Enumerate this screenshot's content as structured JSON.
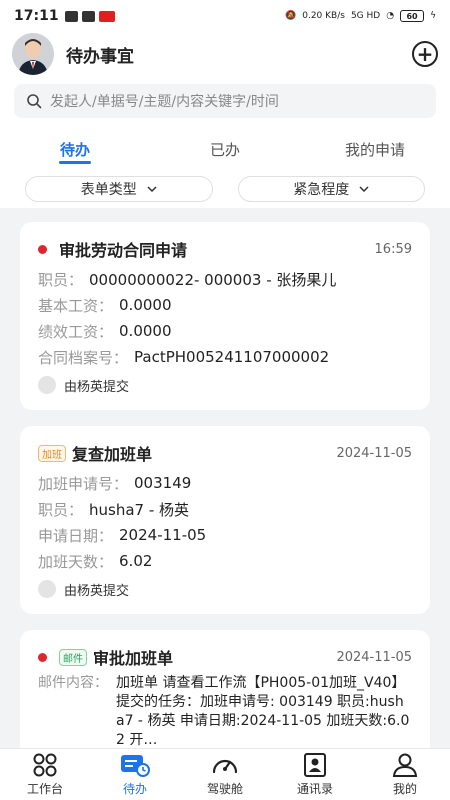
{
  "status_bar": {
    "time": "17:11",
    "net_speed": "0.20 KB/s",
    "network": "5G HD",
    "battery": "60"
  },
  "header": {
    "title": "待办事宜",
    "add_icon": "plus-circle-icon"
  },
  "search": {
    "placeholder": "发起人/单据号/主题/内容关键字/时间"
  },
  "tabs": [
    {
      "label": "待办",
      "active": true
    },
    {
      "label": "已办",
      "active": false
    },
    {
      "label": "我的申请",
      "active": false
    }
  ],
  "filters": [
    {
      "label": "表单类型"
    },
    {
      "label": "紧急程度"
    }
  ],
  "cards": [
    {
      "title": "审批劳动合同申请",
      "time": "16:59",
      "rows": [
        {
          "label": "职员：",
          "value": "00000000022- 000003 - 张扬果儿"
        },
        {
          "label": "基本工资：",
          "value": "0.0000"
        },
        {
          "label": "绩效工资：",
          "value": "0.0000"
        },
        {
          "label": "合同档案号：",
          "value": "PactPH005241107000002"
        }
      ],
      "submitter": "由杨英提交"
    },
    {
      "tag": "加班",
      "title": "复查加班单",
      "time": "2024-11-05",
      "rows": [
        {
          "label": "加班申请号：",
          "value": "003149"
        },
        {
          "label": "职员：",
          "value": "husha7 - 杨英"
        },
        {
          "label": "申请日期：",
          "value": "2024-11-05"
        },
        {
          "label": "加班天数：",
          "value": "6.02"
        }
      ],
      "submitter": "由杨英提交"
    },
    {
      "tag": "邮件",
      "title": "审批加班单",
      "time": "2024-11-05",
      "mail_label": "邮件内容：",
      "mail_content": "加班单 请查看工作流【PH005-01加班_V40】提交的任务：加班申请号: 003149 职员:husha7 - 杨英 申请日期:2024-11-05 加班天数:6.02 开…"
    }
  ],
  "bottom_nav": [
    {
      "label": "工作台",
      "icon": "grid-icon",
      "active": false
    },
    {
      "label": "待办",
      "icon": "todo-icon",
      "active": true
    },
    {
      "label": "驾驶舱",
      "icon": "dashboard-gauge-icon",
      "active": false
    },
    {
      "label": "通讯录",
      "icon": "contacts-icon",
      "active": false
    },
    {
      "label": "我的",
      "icon": "user-icon",
      "active": false
    }
  ],
  "colors": {
    "accent": "#1e73e8",
    "unread_dot": "#e0252b",
    "tag_orange": "#e08a1e",
    "tag_green": "#27a35a"
  }
}
